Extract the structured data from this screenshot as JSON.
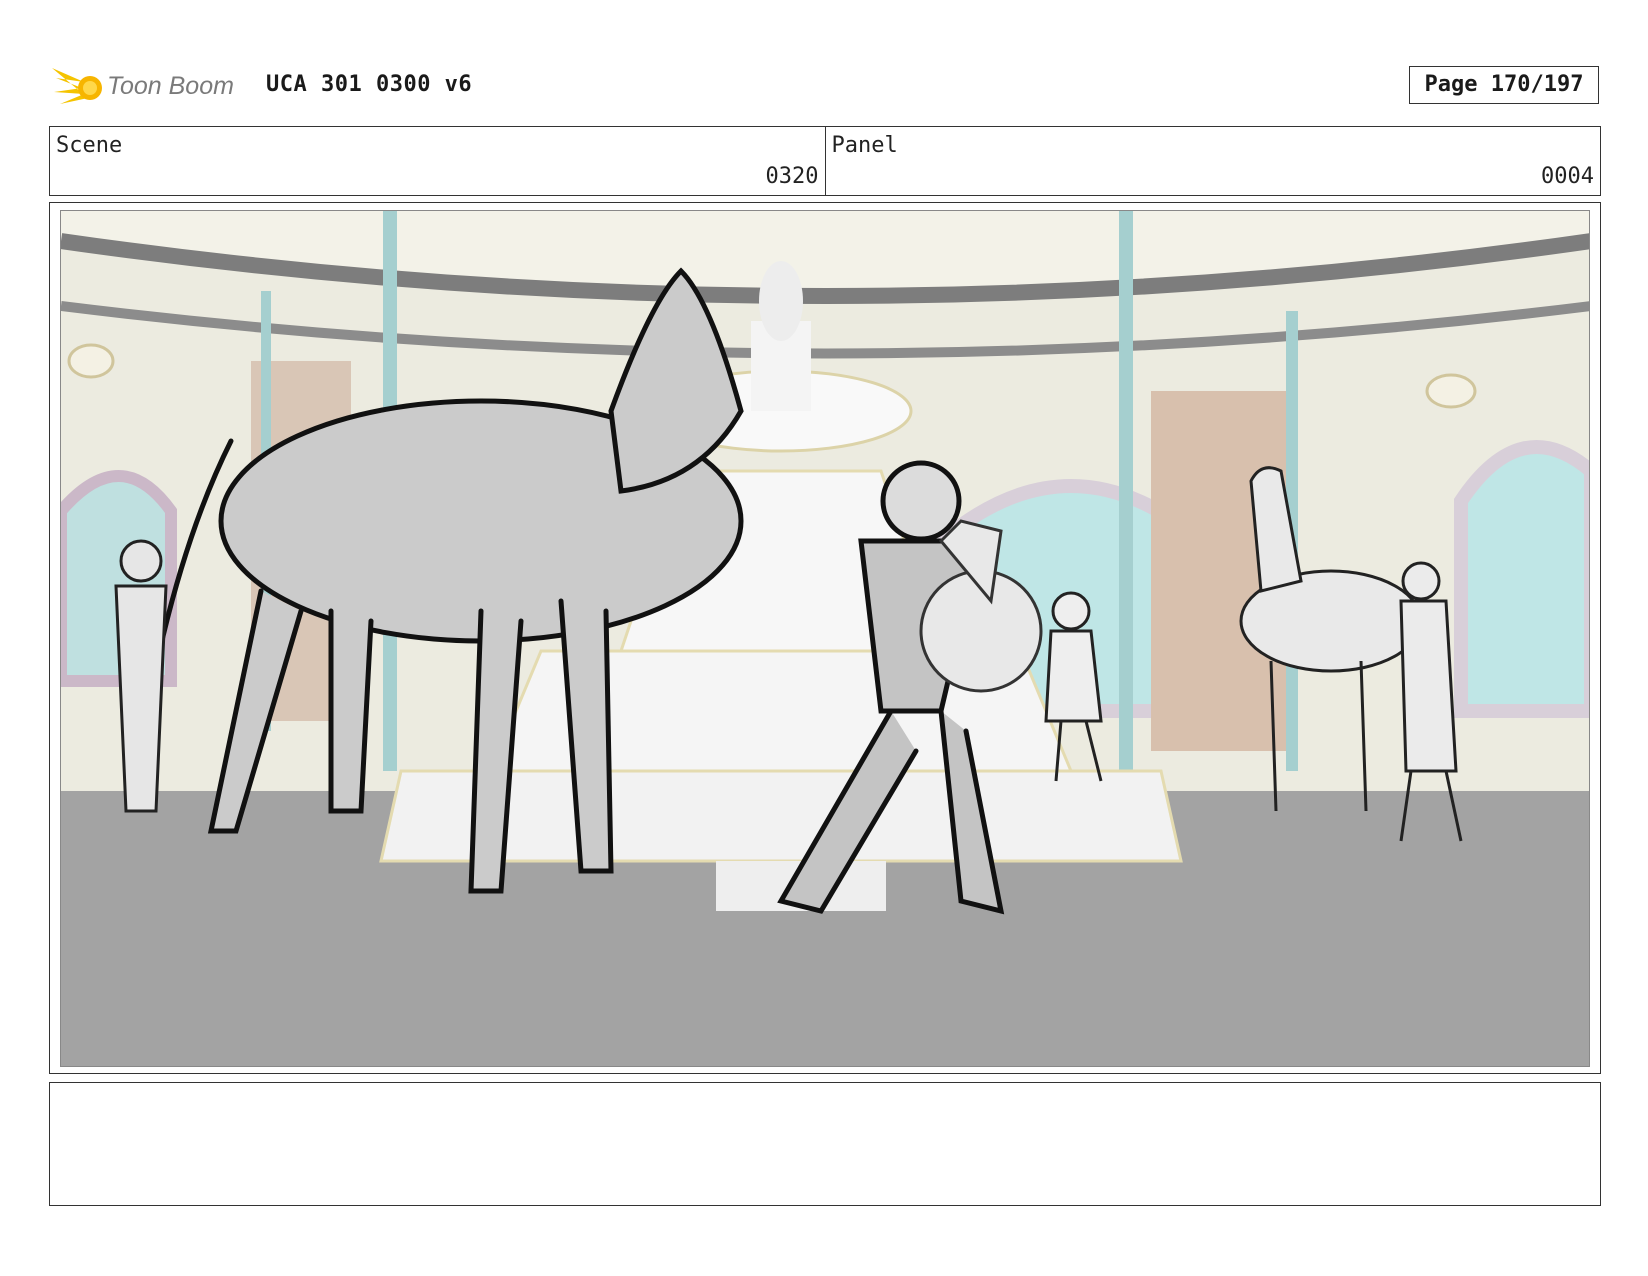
{
  "header": {
    "logo_text": "Toon Boom",
    "doc_title": "UCA 301 0300 v6",
    "page_label": "Page 170/197"
  },
  "info": {
    "scene_label": "Scene",
    "scene_value": "0320",
    "panel_label": "Panel",
    "panel_value": "0004"
  },
  "panel": {
    "image_description_icon": "storyboard-drawing-icon"
  },
  "notes": {
    "text": ""
  }
}
